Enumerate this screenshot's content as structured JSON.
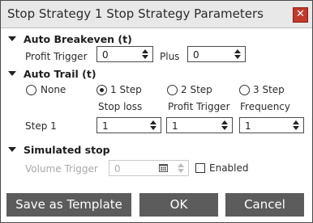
{
  "dialog": {
    "title": "Stop Strategy 1 Stop Strategy Parameters",
    "close_glyph": "✕"
  },
  "auto_breakeven": {
    "header": "Auto Breakeven (t)",
    "profit_trigger_label": "Profit Trigger",
    "profit_trigger_value": "0",
    "plus_label": "Plus",
    "plus_value": "0"
  },
  "auto_trail": {
    "header": "Auto Trail (t)",
    "options": [
      "None",
      "1 Step",
      "2 Step",
      "3 Step"
    ],
    "selected": "1 Step",
    "columns": [
      "Stop loss",
      "Profit Trigger",
      "Frequency"
    ],
    "row_label": "Step 1",
    "row_values": [
      "1",
      "1",
      "1"
    ]
  },
  "simulated_stop": {
    "header": "Simulated stop",
    "volume_trigger_label": "Volume Trigger",
    "volume_trigger_value": "0",
    "enabled_label": "Enabled",
    "enabled_checked": false
  },
  "buttons": {
    "save_template": "Save as Template",
    "ok": "OK",
    "cancel": "Cancel"
  },
  "icons": {
    "close": "close-icon",
    "collapse": "chevron-down-icon",
    "spin": "spinner-arrows-icon",
    "calendar": "calendar-icon"
  },
  "colors": {
    "title_bar": "#e8e8e8",
    "close_button": "#c0392b",
    "button_bg": "#5c5c5c",
    "disabled_text": "#a8a8a8"
  }
}
